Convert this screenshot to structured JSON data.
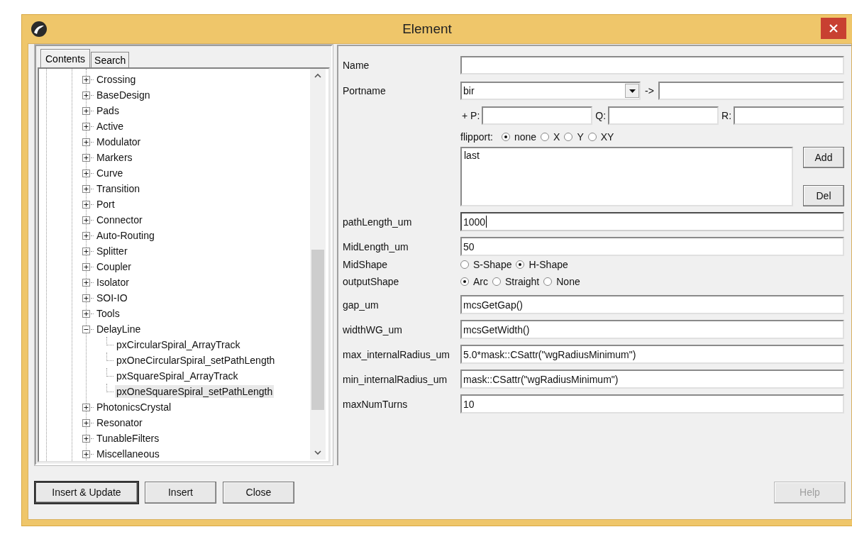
{
  "window": {
    "title": "Element"
  },
  "tabs": [
    {
      "label": "Contents",
      "selected": true
    },
    {
      "label": "Search",
      "selected": false
    }
  ],
  "tree": [
    {
      "label": "Crossing",
      "expanded": false,
      "selected": false
    },
    {
      "label": "BaseDesign",
      "expanded": false,
      "selected": false
    },
    {
      "label": "Pads",
      "expanded": false,
      "selected": false
    },
    {
      "label": "Active",
      "expanded": false,
      "selected": false
    },
    {
      "label": "Modulator",
      "expanded": false,
      "selected": false
    },
    {
      "label": "Markers",
      "expanded": false,
      "selected": false
    },
    {
      "label": "Curve",
      "expanded": false,
      "selected": false
    },
    {
      "label": "Transition",
      "expanded": false,
      "selected": false
    },
    {
      "label": "Port",
      "expanded": false,
      "selected": false
    },
    {
      "label": "Connector",
      "expanded": false,
      "selected": false
    },
    {
      "label": "Auto-Routing",
      "expanded": false,
      "selected": false
    },
    {
      "label": "Splitter",
      "expanded": false,
      "selected": false
    },
    {
      "label": "Coupler",
      "expanded": false,
      "selected": false
    },
    {
      "label": "Isolator",
      "expanded": false,
      "selected": false
    },
    {
      "label": "SOI-IO",
      "expanded": false,
      "selected": false
    },
    {
      "label": "Tools",
      "expanded": false,
      "selected": false
    },
    {
      "label": "DelayLine",
      "expanded": true,
      "selected": false,
      "children": [
        {
          "label": "pxCircularSpiral_ArrayTrack",
          "selected": false
        },
        {
          "label": "pxOneCircularSpiral_setPathLength",
          "selected": false
        },
        {
          "label": "pxSquareSpiral_ArrayTrack",
          "selected": false
        },
        {
          "label": "pxOneSquareSpiral_setPathLength",
          "selected": true
        }
      ]
    },
    {
      "label": "PhotonicsCrystal",
      "expanded": false,
      "selected": false
    },
    {
      "label": "Resonator",
      "expanded": false,
      "selected": false
    },
    {
      "label": "TunableFilters",
      "expanded": false,
      "selected": false
    },
    {
      "label": "Miscellaneous",
      "expanded": false,
      "selected": false
    }
  ],
  "name": {
    "label": "Name"
  },
  "portname": {
    "label": "Portname",
    "value": "bir",
    "arrow": "->"
  },
  "offsets": [
    {
      "label": "+ P:"
    },
    {
      "label": "Q:"
    },
    {
      "label": "R:"
    }
  ],
  "flipport": {
    "label": "flipport:",
    "options": [
      {
        "label": "none",
        "selected": true
      },
      {
        "label": "X",
        "selected": false
      },
      {
        "label": "Y",
        "selected": false
      },
      {
        "label": "XY",
        "selected": false
      }
    ]
  },
  "port_list": {
    "items": [
      "last"
    ],
    "buttons": [
      "Add",
      "Del"
    ]
  },
  "params": [
    {
      "kind": "text",
      "label": "pathLength_um",
      "value": "1000",
      "focused": true
    },
    {
      "kind": "text",
      "label": "MidLength_um",
      "value": "50",
      "focused": false
    },
    {
      "kind": "radio",
      "label": "MidShape",
      "options": [
        {
          "label": "S-Shape",
          "selected": false
        },
        {
          "label": "H-Shape",
          "selected": true
        }
      ]
    },
    {
      "kind": "radio",
      "label": "outputShape",
      "options": [
        {
          "label": "Arc",
          "selected": true
        },
        {
          "label": "Straight",
          "selected": false
        },
        {
          "label": "None",
          "selected": false
        }
      ]
    },
    {
      "kind": "text",
      "label": "gap_um",
      "value": "mcsGetGap()",
      "focused": false
    },
    {
      "kind": "text",
      "label": "widthWG_um",
      "value": "mcsGetWidth()",
      "focused": false
    },
    {
      "kind": "text",
      "label": "max_internalRadius_um",
      "value": "5.0*mask::CSattr(\"wgRadiusMinimum\")",
      "focused": false
    },
    {
      "kind": "text",
      "label": "min_internalRadius_um",
      "value": "mask::CSattr(\"wgRadiusMinimum\")",
      "focused": false
    },
    {
      "kind": "text",
      "label": "maxNumTurns",
      "value": "10",
      "focused": false
    }
  ],
  "buttons": [
    {
      "label": "Insert & Update",
      "default": true,
      "disabled": false
    },
    {
      "label": "Insert",
      "default": false,
      "disabled": false
    },
    {
      "label": "Close",
      "default": false,
      "disabled": false
    },
    {
      "label": "Help",
      "default": false,
      "disabled": true
    }
  ]
}
